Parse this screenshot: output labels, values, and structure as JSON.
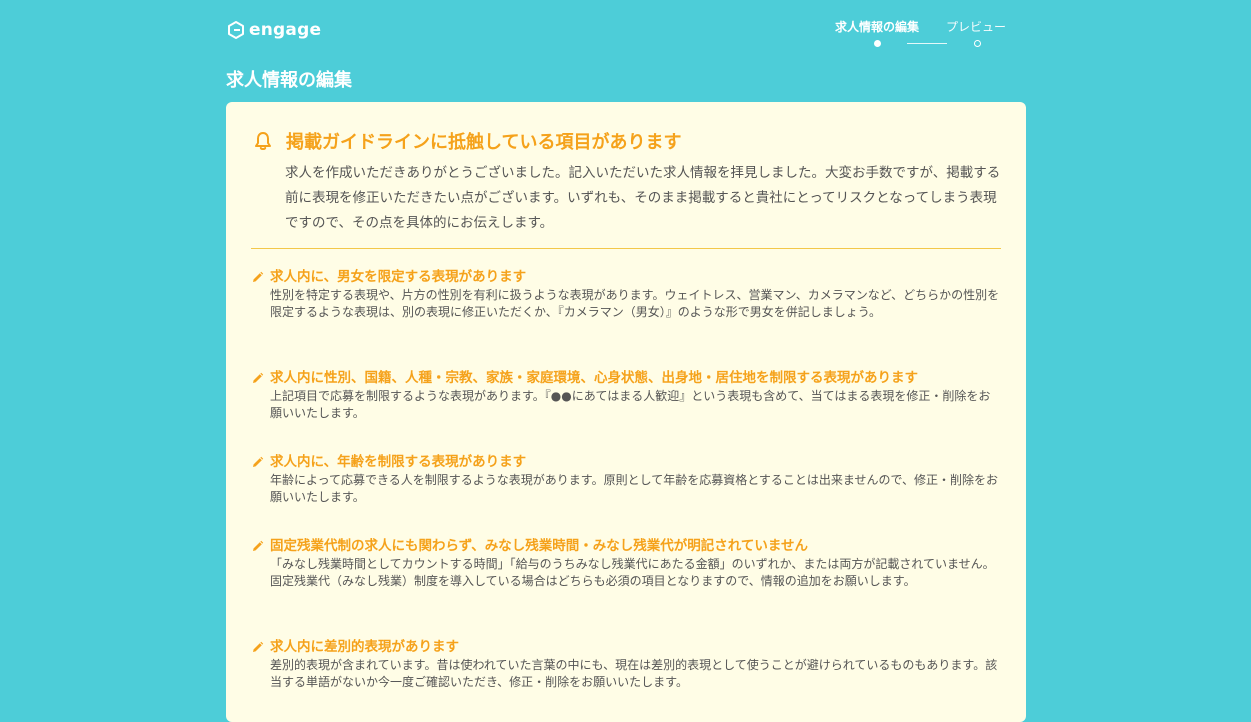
{
  "header": {
    "logo_text": "engage",
    "steps": [
      {
        "label": "求人情報の編集",
        "active": true
      },
      {
        "label": "プレビュー",
        "active": false
      }
    ]
  },
  "page": {
    "title": "求人情報の編集"
  },
  "alert": {
    "icon": "bell-icon",
    "title": "掲載ガイドラインに抵触している項目があります",
    "description": "求人を作成いただきありがとうございました。記入いただいた求人情報を拝見しました。大変お手数ですが、掲載する前に表現を修正いただきたい点がございます。いずれも、そのまま掲載すると貴社にとってリスクとなってしまう表現ですので、その点を具体的にお伝えします。"
  },
  "issues": [
    {
      "icon": "pencil-icon",
      "title": "求人内に、男女を限定する表現があります",
      "body": "性別を特定する表現や、片方の性別を有利に扱うような表現があります。ウェイトレス、営業マン、カメラマンなど、どちらかの性別を限定するような表現は、別の表現に修正いただくか、『カメラマン（男女）』のような形で男女を併記しましょう。"
    },
    {
      "icon": "pencil-icon",
      "title": "求人内に性別、国籍、人種・宗教、家族・家庭環境、心身状態、出身地・居住地を制限する表現があります",
      "body": "上記項目で応募を制限するような表現があります。『●●にあてはまる人歓迎』という表現も含めて、当てはまる表現を修正・削除をお願いいたします。"
    },
    {
      "icon": "pencil-icon",
      "title": "求人内に、年齢を制限する表現があります",
      "body": "年齢によって応募できる人を制限するような表現があります。原則として年齢を応募資格とすることは出来ませんので、修正・削除をお願いいたします。"
    },
    {
      "icon": "pencil-icon",
      "title": "固定残業代制の求人にも関わらず、みなし残業時間・みなし残業代が明記されていません",
      "body": "「みなし残業時間としてカウントする時間」「給与のうちみなし残業代にあたる金額」のいずれか、または両方が記載されていません。固定残業代（みなし残業）制度を導入している場合はどちらも必須の項目となりますので、情報の追加をお願いします。"
    },
    {
      "icon": "pencil-icon",
      "title": "求人内に差別的表現があります",
      "body": "差別的表現が含まれています。昔は使われていた言葉の中にも、現在は差別的表現として使うことが避けられているものもあります。該当する単語がないか今一度ご確認いただき、修正・削除をお願いいたします。"
    }
  ],
  "colors": {
    "background": "#4dcdd8",
    "card": "#fffde6",
    "accent": "#f5a21b",
    "divider": "#f3c84a",
    "body_text": "#555555"
  }
}
